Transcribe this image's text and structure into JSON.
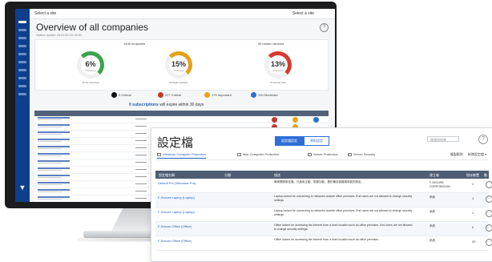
{
  "back_app": {
    "topbar_left": "Select a site",
    "topbar_right": "Select a site",
    "title": "Overview of all companies",
    "subtitle": "Status update 2019-06-20 00:00",
    "card_header_left": "1435 endpoints",
    "card_header_right": "55 hidden devices",
    "gauges": [
      {
        "value": "6%",
        "label": "Protected",
        "caption": "All AV protected",
        "color": "#3aa34a"
      },
      {
        "value": "15%",
        "label": "Protected",
        "caption": "Software updates",
        "color": "#e3a21a"
      },
      {
        "value": "13%",
        "label": "Protected",
        "caption": "Protected ratio",
        "color": "#d63b2f"
      }
    ],
    "legend": [
      {
        "label": "0 Critical",
        "color": "#111111"
      },
      {
        "label": "227 Critical",
        "color": "#c0392b"
      },
      {
        "label": "175 Important",
        "color": "#e6a417"
      },
      {
        "label": "190 Moderate",
        "color": "#2b6fd6"
      }
    ],
    "banner_prefix": "",
    "banner_bold": "0 subscriptions",
    "banner_suffix": " will expire within 30 days",
    "side_logo": "▼"
  },
  "front_panel": {
    "title": "設定檔",
    "segments": [
      "設定檔設定",
      "原則設定"
    ],
    "search_placeholder": "篩選與搜尋",
    "help": "?",
    "tabs": [
      "Windows Computer Protection",
      "Mac Computer Protection",
      "Server Protection",
      "Server Security"
    ],
    "right_links": [
      "複製範例",
      "新增設定檔 ▾"
    ],
    "columns": {
      "name": "設定檔名稱",
      "type": "分類",
      "desc": "描述",
      "owner": "建立者",
      "count": "指派裝置",
      "action": "動作"
    },
    "rows": [
      {
        "name": "Default Pro (Windows Pro)",
        "sub": "",
        "desc": "專案預設設定檔，已啟用主動、防禦功能，基於最佳保護與效能的設定。",
        "owner": "F-SECURE CORPORATION",
        "count": "1",
        "action": "⋯"
      },
      {
        "name": "F-Secure Laptop (Laptop)",
        "sub": "-",
        "desc": "Laptop locked for connecting to networks outside office premises. End users are not allowed to change security settings.",
        "owner": "系統",
        "count": "1",
        "action": "⋯"
      },
      {
        "name": "F-Secure Laptop (Laptop)",
        "sub": "-",
        "desc": "Laptop locked for connecting to networks outside office premises. End users are not allowed to change security settings.",
        "owner": "系統",
        "count": "1",
        "action": "⋯"
      },
      {
        "name": "F-Secure Office (Office)",
        "sub": "-",
        "desc": "Office locked for accessing the internet from a fixed location such as office premises. End users are not allowed to change security settings.",
        "owner": "系統",
        "count": "0",
        "action": "⋯"
      },
      {
        "name": "F-Secure Office (Office)",
        "sub": "-",
        "desc": "Office locked for accessing the internet from a fixed location such as office premises.",
        "owner": "系統",
        "count": "20",
        "action": "⋯"
      }
    ]
  }
}
